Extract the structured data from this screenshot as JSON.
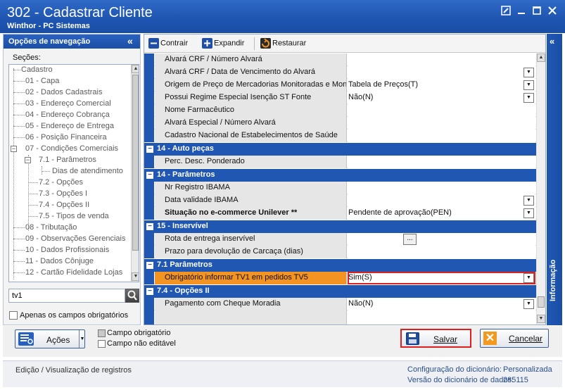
{
  "window": {
    "title": "302 - Cadastrar Cliente",
    "subtitle": "Winthor - PC Sistemas",
    "controls": [
      "edit-icon",
      "minimize-icon",
      "maximize-icon",
      "close-icon"
    ]
  },
  "nav": {
    "header": "Opções de navegação",
    "collapse": "«",
    "sections_label": "Seções:",
    "items": [
      "Cadastro",
      "01 - Capa",
      "02 - Dados Cadastrais",
      "03 - Endereço Comercial",
      "04 - Endereço Cobrança",
      "05 - Endereço de Entrega",
      "06 - Posição Financeira",
      "07 - Condições Comerciais",
      "7.1 - Parâmetros",
      "Dias de atendimento",
      "7.2 - Opções",
      "7.3 - Opções I",
      "7.4 - Opções II",
      "7.5 - Tipos de venda",
      "08 - Tributação",
      "09 - Observações Gerenciais",
      "10 - Dados Profissionais",
      "11 - Dados Cônjuge",
      "12 - Cartão Fidelidade Lojas"
    ],
    "search_value": "tv1",
    "required_only_label": "Apenas os campos obrigatórios"
  },
  "toolbar": {
    "collapse_label": "Contrair",
    "expand_label": "Expandir",
    "restore_label": "Restaurar"
  },
  "grid": {
    "rows": [
      {
        "kind": "field",
        "label": "Alvará CRF / Número Alvará",
        "value": ""
      },
      {
        "kind": "field",
        "label": "Alvará CRF / Data  de Vencimento do Alvará",
        "value": "",
        "dropdown": true
      },
      {
        "kind": "field",
        "label": "Origem de Preço de Mercadorias Monitoradas e Monit",
        "value": "Tabela de Preços(T)",
        "dropdown": true
      },
      {
        "kind": "field",
        "label": "Possui Regime Especial Isenção ST Fonte",
        "value": "Não(N)",
        "dropdown": true
      },
      {
        "kind": "field",
        "label": "Nome Farmacêutico",
        "value": ""
      },
      {
        "kind": "field",
        "label": "Alvará Especial / Número Alvará",
        "value": ""
      },
      {
        "kind": "field",
        "label": "Cadastro Nacional de Estabelecimentos de Saúde",
        "value": ""
      },
      {
        "kind": "group",
        "label": "14 - Auto peças"
      },
      {
        "kind": "field",
        "label": "Perc. Desc. Ponderado",
        "value": ""
      },
      {
        "kind": "group",
        "label": "14 - Parâmetros"
      },
      {
        "kind": "field",
        "label": "Nr Registro IBAMA",
        "value": ""
      },
      {
        "kind": "field",
        "label": "Data validade IBAMA",
        "value": "",
        "dropdown": true
      },
      {
        "kind": "field",
        "label": "Situação no e-commerce Unilever **",
        "value": "Pendente de aprovação(PEN)",
        "dropdown": true,
        "bold": true
      },
      {
        "kind": "group",
        "label": "15 - Inservível"
      },
      {
        "kind": "field",
        "label": "Rota de entrega inservível",
        "value": "",
        "ellipsis": "..."
      },
      {
        "kind": "field",
        "label": "Prazo para devolução de Carcaça (dias)",
        "value": ""
      },
      {
        "kind": "group",
        "label": "7.1 Parâmetros"
      },
      {
        "kind": "field",
        "label": "Obrigatório informar TV1 em pedidos TV5",
        "value": "Sim(S)",
        "dropdown": true,
        "highlight": true
      },
      {
        "kind": "group",
        "label": "7.4 - Opções II"
      },
      {
        "kind": "field",
        "label": "Pagamento com Cheque Moradia",
        "value": "Não(N)",
        "dropdown": true
      }
    ]
  },
  "info_panel": {
    "label": "Informação",
    "collapse": "«"
  },
  "actions": {
    "acoes_label": "Ações",
    "legend_required": "Campo obrigatório",
    "legend_readonly": "Campo não editável",
    "save_label": "Salvar",
    "cancel_label": "Cancelar"
  },
  "status": {
    "mode": "Edição / Visualização de registros",
    "config_label": "Configuração do dicionário:",
    "config_value": "Personalizada",
    "version_label": "Versão do dicionário de dados:",
    "version_value": "285115"
  },
  "colors": {
    "title_blue": "#1f56b2",
    "group_blue": "#1f57b3",
    "highlight_orange": "#f39322",
    "highlight_border": "#e02020"
  }
}
